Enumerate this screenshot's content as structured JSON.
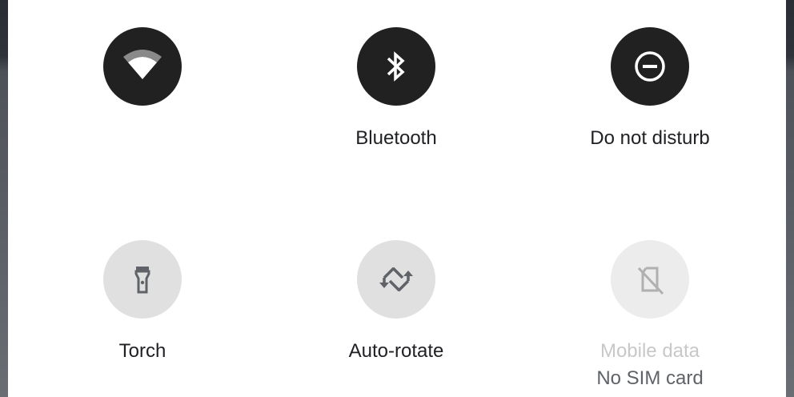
{
  "quick_settings": {
    "tiles": [
      {
        "id": "wifi",
        "label": "",
        "state": "on",
        "icon": "wifi-icon"
      },
      {
        "id": "bluetooth",
        "label": "Bluetooth",
        "state": "on",
        "icon": "bluetooth-icon"
      },
      {
        "id": "dnd",
        "label": "Do not disturb",
        "state": "on",
        "icon": "do-not-disturb-icon"
      },
      {
        "id": "torch",
        "label": "Torch",
        "state": "off",
        "icon": "flashlight-icon"
      },
      {
        "id": "autorotate",
        "label": "Auto-rotate",
        "state": "off",
        "icon": "auto-rotate-icon"
      },
      {
        "id": "mobile-data",
        "label": "Mobile data",
        "sublabel": "No SIM card",
        "state": "disabled",
        "icon": "no-sim-icon"
      }
    ]
  },
  "colors": {
    "tile_on": "#212121",
    "tile_off": "#e0e0e0",
    "icon_on": "#ffffff",
    "icon_off": "#5f6368",
    "label": "#202124",
    "label_disabled": "#c8c8c8"
  }
}
